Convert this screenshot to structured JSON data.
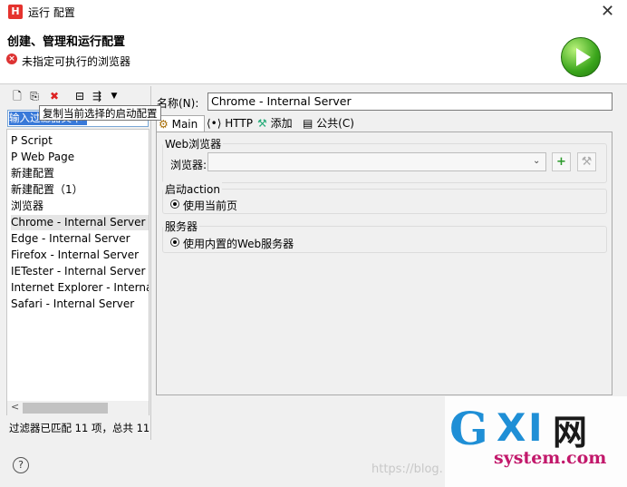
{
  "window": {
    "title": "运行 配置",
    "app_icon": "H",
    "close_icon": "close-icon"
  },
  "header": {
    "title": "创建、管理和运行配置",
    "error_message": "未指定可执行的浏览器",
    "error_icon": "error-icon",
    "run_icon": "run-icon"
  },
  "left_toolbar": {
    "buttons": [
      "new-config-icon",
      "duplicate-icon",
      "delete-icon",
      "collapse-icon",
      "filter-icon",
      "dropdown-icon"
    ],
    "tooltip": "复制当前选择的启动配置"
  },
  "filter": {
    "text": "输入过滤器文本"
  },
  "tree": {
    "items": [
      "P Script",
      "P Web Page",
      "新建配置",
      "新建配置（1）",
      "浏览器",
      "Chrome - Internal Server",
      "Edge - Internal Server",
      "Firefox - Internal Server",
      "IETester - Internal Server",
      "Internet Explorer - Internal",
      "Safari - Internal Server"
    ],
    "selected_index": 5
  },
  "status": "过滤器已匹配 11 项，总共 11",
  "form": {
    "name_label": "名称(N):",
    "name_value": "Chrome - Internal Server",
    "tabs": [
      "Main",
      "HTTP",
      "添加",
      "公共(C)"
    ],
    "active_tab": "Main",
    "web_browser_group": "Web浏览器",
    "browser_label": "浏览器:",
    "browser_value": "",
    "start_action_group": "启动action",
    "use_current_page": "使用当前页",
    "server_group": "服务器",
    "use_builtin_server": "使用内置的Web服务器"
  },
  "footer": {
    "help_icon": "help-icon"
  },
  "watermark": {
    "url_text": "https://blog.",
    "logo_main": "GXI网",
    "logo_sub": "system.com"
  },
  "colors": {
    "selection": "#3879d9",
    "accent_green": "#3aa51b",
    "error_red": "#d33333"
  }
}
